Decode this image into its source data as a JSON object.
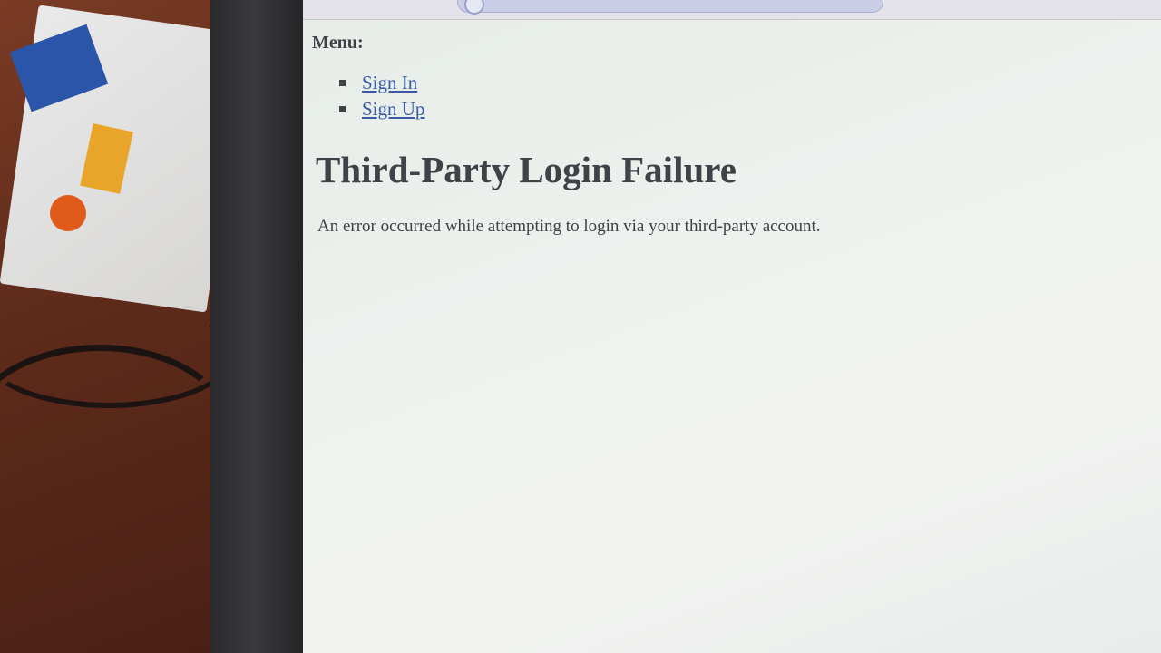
{
  "menu": {
    "label": "Menu:",
    "items": [
      {
        "label": "Sign In"
      },
      {
        "label": "Sign Up"
      }
    ]
  },
  "page": {
    "title": "Third-Party Login Failure",
    "message": "An error occurred while attempting to login via your third-party account."
  },
  "colors": {
    "link": "#3a5aa8",
    "text": "#3e4247",
    "screen_bg": "#eef1ee"
  },
  "icons": {
    "list_bullet": "square-bullet-icon"
  }
}
